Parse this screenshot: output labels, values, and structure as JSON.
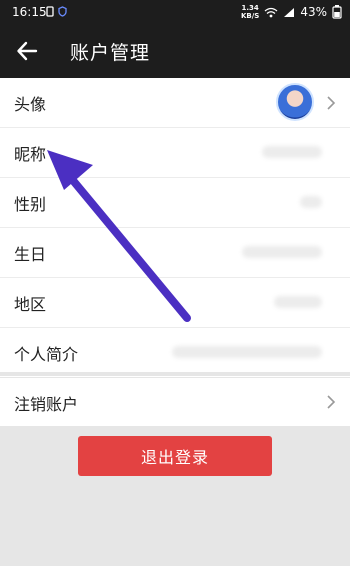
{
  "status_bar": {
    "time": "16:15",
    "speed_value": "1.34",
    "speed_unit": "KB/S",
    "battery": "43%"
  },
  "header": {
    "title": "账户管理"
  },
  "settings": {
    "items": [
      {
        "label": "头像"
      },
      {
        "label": "昵称"
      },
      {
        "label": "性别"
      },
      {
        "label": "生日"
      },
      {
        "label": "地区"
      },
      {
        "label": "个人简介"
      }
    ]
  },
  "account": {
    "cancel_label": "注销账户"
  },
  "logout_button": {
    "label": "退出登录"
  },
  "colors": {
    "header_bg": "#1d1d1d",
    "logout_bg": "#e34242",
    "arrow": "#4b2fc2"
  }
}
